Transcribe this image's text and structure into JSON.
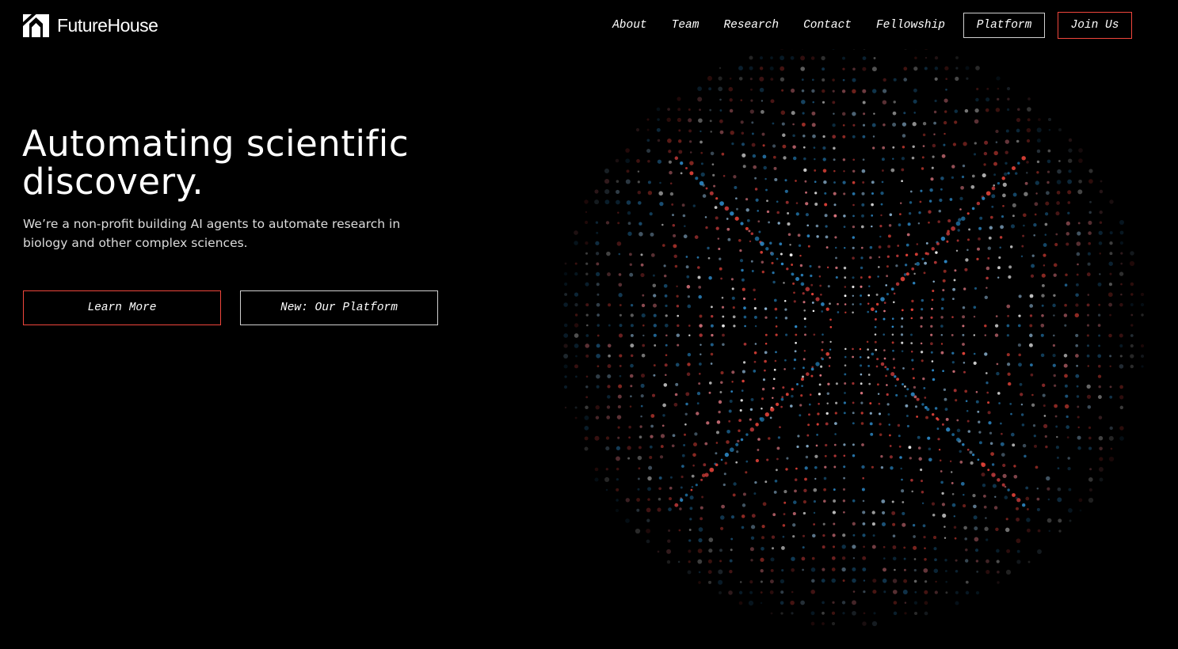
{
  "brand": {
    "name": "FutureHouse",
    "logo_icon": "futurehouse-house-icon"
  },
  "nav": {
    "links": [
      "About",
      "Team",
      "Research",
      "Contact",
      "Fellowship"
    ],
    "platform_label": "Platform",
    "join_label": "Join Us"
  },
  "hero": {
    "title": "Automating scientific discovery.",
    "subtitle": "We’re a non-profit building AI agents to automate research in biology and other complex sciences.",
    "learn_more_label": "Learn More",
    "platform_label": "New: Our Platform"
  },
  "colors": {
    "background": "#000000",
    "text": "#ffffff",
    "accent_red": "#f0463c",
    "accent_blue": "#2f8fd0",
    "outline_light": "#d0d0d0"
  }
}
